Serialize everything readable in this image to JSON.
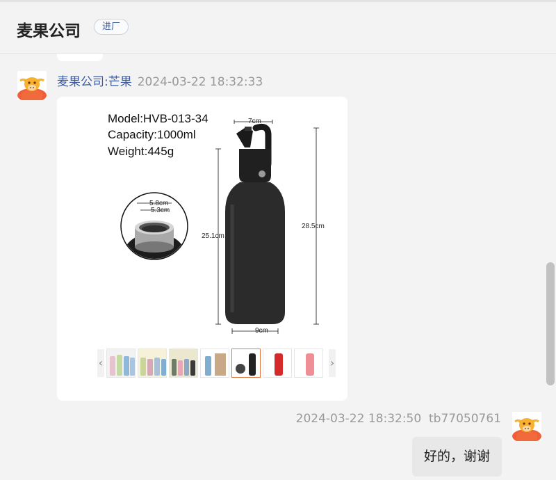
{
  "header": {
    "shop_name": "麦果公司",
    "badge": "进厂"
  },
  "messages": [
    {
      "sender": "麦果公司:芒果",
      "time": "2024-03-22 18:32:33",
      "image": {
        "model": "Model:HVB-013-34",
        "capacity": "Capacity:1000ml",
        "weight": "Weight:445g",
        "dims": {
          "top_width": "7cm",
          "height_total": "28.5cm",
          "height_body": "25.1cm",
          "bottom_width": "9cm",
          "mouth_outer": "5.8cm",
          "mouth_inner": "5.3cm"
        },
        "thumbnails": [
          {
            "icon": "bottles-blue-green-thumb",
            "colors": [
              "#8fb7d8",
              "#c5d9a3",
              "#e6c3cf"
            ]
          },
          {
            "icon": "bottles-pastel-thumb",
            "colors": [
              "#c9d59b",
              "#d6a9b8",
              "#a9c1d8"
            ]
          },
          {
            "icon": "bottles-multi-thumb",
            "colors": [
              "#6b7d6a",
              "#e6a8b4",
              "#8fa7c7"
            ]
          },
          {
            "icon": "bottle-with-box-thumb",
            "colors": [
              "#7faed0",
              "#c9a888"
            ]
          },
          {
            "icon": "black-bottle-thumb",
            "colors": [
              "#222222"
            ],
            "active": true
          },
          {
            "icon": "red-bottle-thumb",
            "colors": [
              "#d42a2a"
            ]
          },
          {
            "icon": "pink-bottle-thumb",
            "colors": [
              "#ef8f95"
            ]
          }
        ]
      }
    },
    {
      "sender": "tb77050761",
      "time": "2024-03-22 18:32:50",
      "text": "好的，谢谢"
    }
  ]
}
